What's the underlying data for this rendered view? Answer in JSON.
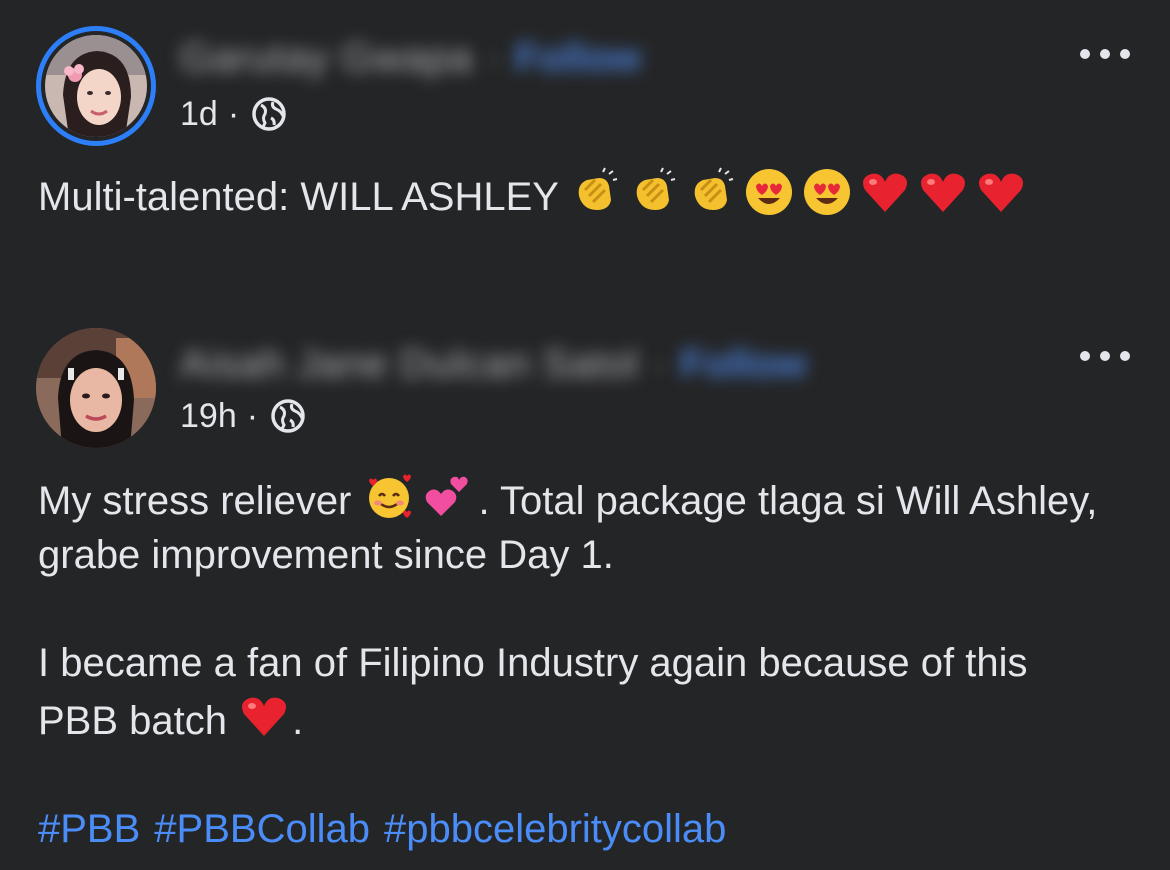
{
  "posts": [
    {
      "author": "Garutay Gwapa",
      "separator": "·",
      "follow": "Follow",
      "time": "1d",
      "meta_dot": "·",
      "privacy_icon": "globe-icon",
      "text": "Multi-talented: WILL ASHLEY",
      "emojis": [
        "clapping-hands",
        "clapping-hands",
        "clapping-hands",
        "heart-eyes",
        "heart-eyes",
        "red-heart",
        "red-heart",
        "red-heart"
      ]
    },
    {
      "author": "Aisah Jane Dulcan Satol",
      "separator": "·",
      "follow": "Follow",
      "time": "19h",
      "meta_dot": "·",
      "privacy_icon": "globe-icon",
      "text_part1": "My stress reliever",
      "text_part2": ". Total package tlaga si Will Ashley, grabe improvement since Day 1.",
      "text_para2_part1": "I became a fan of Filipino Industry again because of this PBB batch",
      "text_para2_part2": ".",
      "hashtags": [
        "#PBB",
        "#PBBCollab",
        "#pbbcelebritycollab"
      ]
    }
  ],
  "colors": {
    "background": "#242526",
    "text": "#e4e6eb",
    "link": "#4b8df8",
    "story_ring": "#2d7ff9"
  }
}
